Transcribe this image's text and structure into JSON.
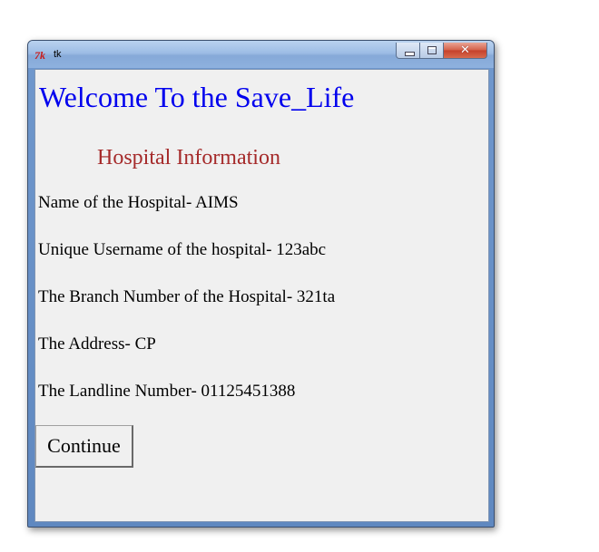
{
  "window": {
    "title": "tk",
    "icon": "tk-feather-icon",
    "controls": {
      "minimize": "minimize-icon",
      "maximize": "maximize-icon",
      "close": "close-icon"
    }
  },
  "content": {
    "heading": "Welcome To the Save_Life",
    "subheading": "Hospital Information",
    "lines": [
      "Name of the Hospital- AIMS",
      "Unique Username of the hospital- 123abc",
      "The Branch Number of the Hospital- 321ta",
      "The Address- CP",
      "The Landline Number- 01125451388"
    ],
    "continue_label": "Continue"
  },
  "colors": {
    "heading": "#0000ee",
    "subheading": "#a52a2a",
    "client_background": "#f0f0f0"
  }
}
